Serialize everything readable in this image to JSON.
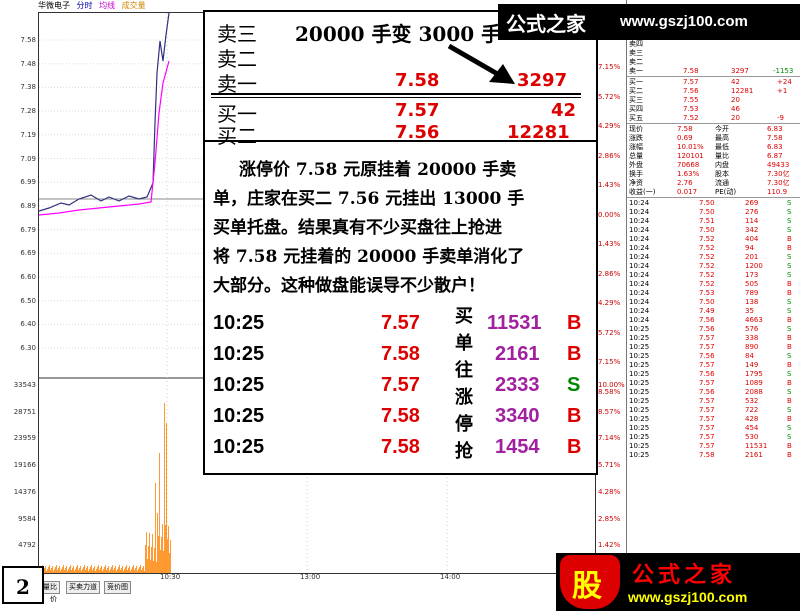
{
  "header": {
    "stock_name": "华微电子",
    "tab_timeshare": "分时",
    "tab_avg": "均线",
    "tab_volume": "成交量"
  },
  "price_axis_left": [
    "7.58",
    "7.48",
    "7.38",
    "7.28",
    "7.19",
    "7.09",
    "6.99",
    "6.89",
    "6.79",
    "6.69",
    "6.60",
    "6.50",
    "6.40",
    "6.30"
  ],
  "price_axis_right": [
    "7.15%",
    "5.72%",
    "4.29%",
    "2.86%",
    "1.43%",
    "0.00%",
    "1.43%",
    "2.86%",
    "4.29%",
    "5.72%",
    "7.15%",
    "8.58%"
  ],
  "volume_axis_left": [
    "33543",
    "28751",
    "23959",
    "19166",
    "14376",
    "9584",
    "4792"
  ],
  "volume_axis_right": [
    "10.00%",
    "8.57%",
    "7.14%",
    "5.71%",
    "4.28%",
    "2.85%",
    "1.42%"
  ],
  "time_axis": [
    "10:30",
    "13:00",
    "14:00"
  ],
  "bottom_tabs": [
    "量比",
    "买卖力道",
    "竞价图"
  ],
  "bottom_tab_label_left": "价",
  "page_number": "2",
  "overlay": {
    "title": "20000 手变 3000 手",
    "ask_rows": [
      {
        "label": "卖三",
        "price": "",
        "qty": ""
      },
      {
        "label": "卖二",
        "price": "",
        "qty": ""
      },
      {
        "label": "卖一",
        "price": "7.58",
        "qty": "3297"
      }
    ],
    "bid_rows": [
      {
        "label": "买一",
        "price": "7.57",
        "qty": "42"
      },
      {
        "label": "买二",
        "price": "7.56",
        "qty": "12281"
      }
    ],
    "paragraph_lines": [
      "涨停价 7.58 元原挂着 20000 手卖",
      "单，庄家在买二 7.56 元挂出 13000 手",
      "买单托盘。结果真有不少买盘往上抢进",
      "将 7.58 元挂着的 20000 手卖单消化了",
      "大部分。这种做盘能误导不少散户！"
    ],
    "trades": [
      {
        "time": "10:25",
        "price": "7.57",
        "vol": "11531",
        "side": "B"
      },
      {
        "time": "10:25",
        "price": "7.58",
        "vol": "2161",
        "side": "B"
      },
      {
        "time": "10:25",
        "price": "7.57",
        "vol": "2333",
        "side": "S"
      },
      {
        "time": "10:25",
        "price": "7.58",
        "vol": "3340",
        "side": "B"
      },
      {
        "time": "10:25",
        "price": "7.58",
        "vol": "1454",
        "side": "B"
      }
    ],
    "vertical_note": [
      "买",
      "单",
      "往",
      "涨",
      "停",
      "抢"
    ]
  },
  "banner_top": {
    "brand": "公式之家",
    "url": "www.gszj100.com"
  },
  "banner_bottom": {
    "logo_char": "股",
    "brand": "公式之家",
    "url": "www.gszj100.com"
  },
  "panel": {
    "asks": [
      {
        "label": "卖四",
        "price": "",
        "qty": "",
        "chg": ""
      },
      {
        "label": "卖三",
        "price": "",
        "qty": "",
        "chg": ""
      },
      {
        "label": "卖二",
        "price": "",
        "qty": "",
        "chg": ""
      },
      {
        "label": "卖一",
        "price": "7.58",
        "qty": "3297",
        "chg": "-1153"
      }
    ],
    "bids": [
      {
        "label": "买一",
        "price": "7.57",
        "qty": "42",
        "chg": "+24"
      },
      {
        "label": "买二",
        "price": "7.56",
        "qty": "12281",
        "chg": "+1"
      },
      {
        "label": "买三",
        "price": "7.55",
        "qty": "20",
        "chg": ""
      },
      {
        "label": "买四",
        "price": "7.53",
        "qty": "46",
        "chg": ""
      },
      {
        "label": "买五",
        "price": "7.52",
        "qty": "20",
        "chg": "-9"
      }
    ],
    "stats": [
      {
        "k1": "现价",
        "v1": "7.58",
        "k2": "今开",
        "v2": "6.83"
      },
      {
        "k1": "涨跌",
        "v1": "0.69",
        "k2": "最高",
        "v2": "7.58"
      },
      {
        "k1": "涨幅",
        "v1": "10.01%",
        "k2": "最低",
        "v2": "6.83"
      },
      {
        "k1": "总量",
        "v1": "120101",
        "k2": "量比",
        "v2": "6.87"
      },
      {
        "k1": "外盘",
        "v1": "70668",
        "k2": "内盘",
        "v2": "49433"
      },
      {
        "k1": "换手",
        "v1": "1.63%",
        "k2": "股本",
        "v2": "7.30亿"
      },
      {
        "k1": "净资",
        "v1": "2.76",
        "k2": "流通",
        "v2": "7.30亿"
      },
      {
        "k1": "收益(一)",
        "v1": "0.017",
        "k2": "PE(动)",
        "v2": "110.9"
      }
    ],
    "ticks": [
      {
        "t": "10:24",
        "p": "7.50",
        "v": "269",
        "s": "S"
      },
      {
        "t": "10:24",
        "p": "7.50",
        "v": "276",
        "s": "S"
      },
      {
        "t": "10:24",
        "p": "7.51",
        "v": "114",
        "s": "S"
      },
      {
        "t": "10:24",
        "p": "7.50",
        "v": "342",
        "s": "S"
      },
      {
        "t": "10:24",
        "p": "7.52",
        "v": "404",
        "s": "B"
      },
      {
        "t": "10:24",
        "p": "7.52",
        "v": "94",
        "s": "B"
      },
      {
        "t": "10:24",
        "p": "7.52",
        "v": "201",
        "s": "S"
      },
      {
        "t": "10:24",
        "p": "7.52",
        "v": "1200",
        "s": "S"
      },
      {
        "t": "10:24",
        "p": "7.52",
        "v": "173",
        "s": "S"
      },
      {
        "t": "10:24",
        "p": "7.52",
        "v": "505",
        "s": "B"
      },
      {
        "t": "10:24",
        "p": "7.53",
        "v": "789",
        "s": "B"
      },
      {
        "t": "10:24",
        "p": "7.50",
        "v": "138",
        "s": "S"
      },
      {
        "t": "10:24",
        "p": "7.49",
        "v": "35",
        "s": "S"
      },
      {
        "t": "10:24",
        "p": "7.56",
        "v": "4663",
        "s": "B"
      },
      {
        "t": "10:25",
        "p": "7.56",
        "v": "576",
        "s": "S"
      },
      {
        "t": "10:25",
        "p": "7.57",
        "v": "338",
        "s": "B"
      },
      {
        "t": "10:25",
        "p": "7.57",
        "v": "890",
        "s": "B"
      },
      {
        "t": "10:25",
        "p": "7.56",
        "v": "84",
        "s": "S"
      },
      {
        "t": "10:25",
        "p": "7.57",
        "v": "149",
        "s": "B"
      },
      {
        "t": "10:25",
        "p": "7.56",
        "v": "1795",
        "s": "S"
      },
      {
        "t": "10:25",
        "p": "7.57",
        "v": "1089",
        "s": "B"
      },
      {
        "t": "10:25",
        "p": "7.56",
        "v": "2088",
        "s": "S"
      },
      {
        "t": "10:25",
        "p": "7.57",
        "v": "532",
        "s": "B"
      },
      {
        "t": "10:25",
        "p": "7.57",
        "v": "722",
        "s": "S"
      },
      {
        "t": "10:25",
        "p": "7.57",
        "v": "428",
        "s": "B"
      },
      {
        "t": "10:25",
        "p": "7.57",
        "v": "454",
        "s": "S"
      },
      {
        "t": "10:25",
        "p": "7.57",
        "v": "530",
        "s": "S"
      },
      {
        "t": "10:25",
        "p": "7.57",
        "v": "11531",
        "s": "B"
      },
      {
        "t": "10:25",
        "p": "7.58",
        "v": "2161",
        "s": "B"
      }
    ]
  },
  "colors": {
    "up": "#e00000",
    "down": "#008000",
    "price_line": "#303080",
    "avg_line": "#ff00ff",
    "volume": "#ff8000",
    "trade_vol": "#a020a0"
  }
}
